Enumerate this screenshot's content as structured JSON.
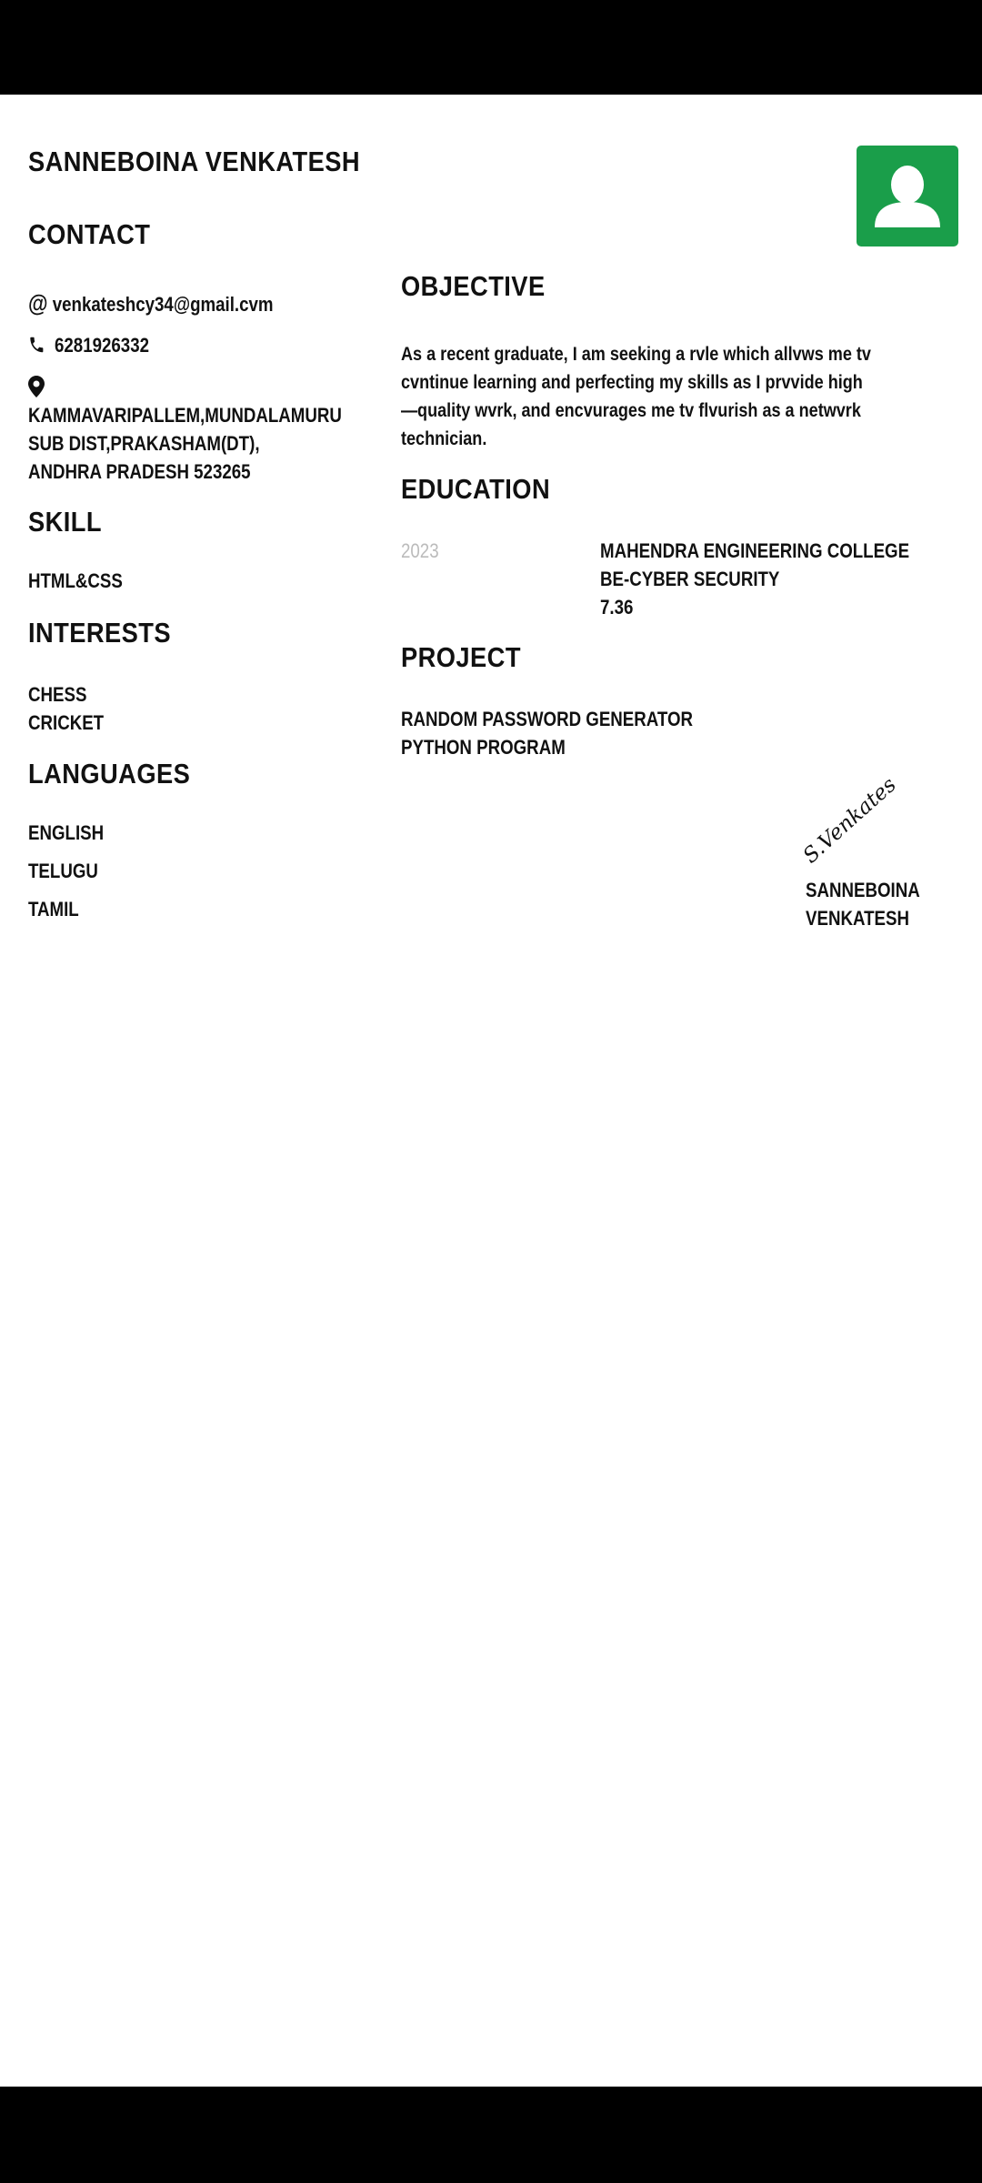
{
  "name": "SANNEBOINA VENKATESH",
  "contact": {
    "heading": "CONTACT",
    "email": "venkateshcy34@gmail.cvm",
    "phone": "6281926332",
    "address": [
      "KAMMAVARIPALLEM,MUNDALAMURU",
      "SUB DIST,PRAKASHAM(DT),",
      "ANDHRA PRADESH 523265"
    ]
  },
  "skill": {
    "heading": "SKILL",
    "items": [
      "HTML&CSS"
    ]
  },
  "interests": {
    "heading": "INTERESTS",
    "items": [
      "CHESS",
      "CRICKET"
    ]
  },
  "languages": {
    "heading": "LANGUAGES",
    "items": [
      "ENGLISH",
      "TELUGU",
      "TAMIL"
    ]
  },
  "objective": {
    "heading": "OBJECTIVE",
    "text": "As a recent graduate, I am seeking a rvle which allvws me tv cvntinue learning and perfecting my skills as I prvvide high—quality wvrk, and encvurages me tv flvurish as a netwvrk technician."
  },
  "education": {
    "heading": "EDUCATION",
    "year": "2023",
    "college": "MAHENDRA ENGINEERING COLLEGE",
    "degree": "BE-CYBER SECURITY",
    "score": "7.36"
  },
  "project": {
    "heading": "PROJECT",
    "items": [
      "RANDOM PASSWORD GENERATOR",
      "PYTHON PROGRAM"
    ]
  },
  "signature": {
    "script": "S.Venkates",
    "name_lines": [
      "SANNEBOINA",
      "VENKATESH"
    ]
  },
  "colors": {
    "avatar_bg": "#1a9e4a",
    "year_text": "#bbbbbb"
  }
}
